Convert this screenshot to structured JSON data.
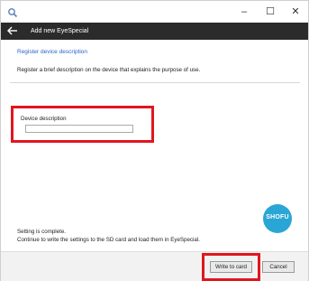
{
  "window": {
    "icon": "search-icon",
    "controls": {
      "minimize": "–",
      "maximize": "☐",
      "close": "✕"
    }
  },
  "header": {
    "back_icon": "arrow-left-icon",
    "title": "Add new EyeSpecial"
  },
  "section": {
    "title": "Register device description",
    "description": "Register a brief description on the device that explains the purpose of use."
  },
  "field": {
    "label": "Device description",
    "value": ""
  },
  "logo": {
    "text": "SHOFU",
    "color": "#2aa6d6"
  },
  "status": {
    "line1": "Setting is complete.",
    "line2": "Continue to write the settings to the SD card and load them in EyeSpecial."
  },
  "footer": {
    "write_label": "Write to card",
    "cancel_label": "Cancel"
  },
  "colors": {
    "accent": "#2a62c8",
    "highlight": "#e0161f",
    "header_bg": "#2b2b2b"
  }
}
